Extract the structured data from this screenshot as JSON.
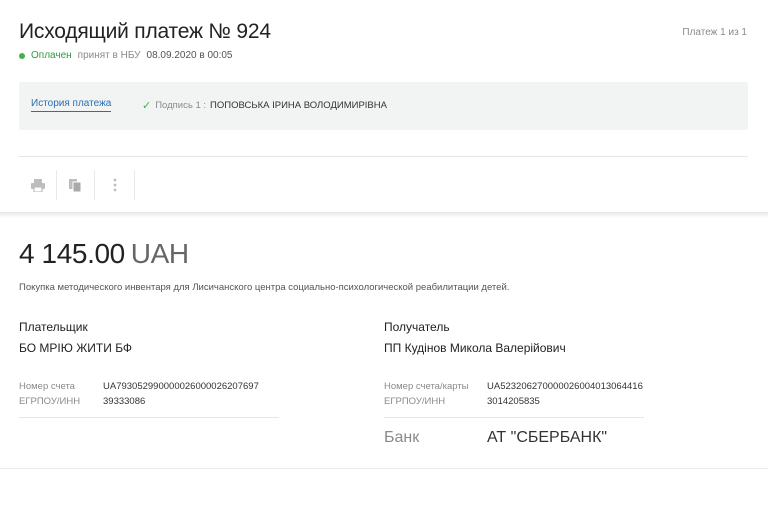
{
  "header": {
    "title": "Исходящий платеж № 924",
    "pager": "Платеж 1 из 1",
    "status": {
      "state": "Оплачен",
      "accepted_text": "принят в НБУ",
      "datetime": "08.09.2020 в 00:05"
    }
  },
  "history": {
    "link_label": "История платежа",
    "signature_label": "Подпись 1 :",
    "signature_name": "ПОПОВСЬКА ІРИНА ВОЛОДИМИРІВНА"
  },
  "toolbar": {
    "icons": [
      "printer-icon",
      "copy-icon",
      "more-vertical-icon"
    ]
  },
  "payment": {
    "amount": "4 145.00",
    "currency": "UAH",
    "purpose": "Покупка методического инвентаря для Лисичанского центра социально-психологической реабилитации детей."
  },
  "payer": {
    "role": "Плательщик",
    "name": "БО МРІЮ ЖИТИ БФ",
    "account_label": "Номер счета",
    "account": "UA793052990000026000026207697",
    "edrpou_label": "ЕГРПОУ/ИНН",
    "edrpou": "39333086"
  },
  "recipient": {
    "role": "Получатель",
    "name": "ПП Кудінов Микола Валерійович",
    "account_label": "Номер счета/карты",
    "account": "UA523206270000026004013064416",
    "edrpou_label": "ЕГРПОУ/ИНН",
    "edrpou": "3014205835",
    "bank_label": "Банк",
    "bank": "АТ \"СБЕРБАНК\""
  },
  "colors": {
    "accent_link": "#2b6fb2",
    "status_green": "#47b04b",
    "panel_bg": "#f2f3f3"
  }
}
